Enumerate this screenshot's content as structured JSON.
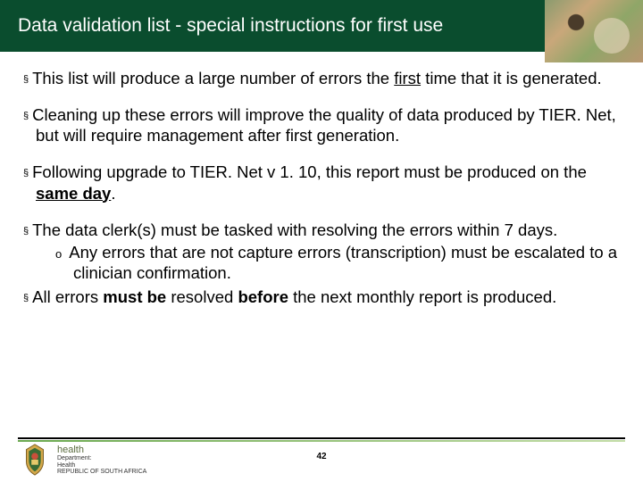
{
  "title": "Data validation list - special instructions for first use",
  "bullets": {
    "b1_pre": "This list will produce a large number of errors the ",
    "b1_u": "first",
    "b1_post": " time that it is generated.",
    "b2": "Cleaning up these errors will improve the quality of data produced by TIER. Net, but will require management after first generation.",
    "b3_pre": "Following upgrade to TIER. Net v 1. 10, this report must be produced on the ",
    "b3_bold": "same day",
    "b3_post": ".",
    "b4": "The data clerk(s) must be tasked with resolving the errors within 7 days.",
    "b4_sub": "Any errors that are not capture errors (transcription) must be escalated to a clinician confirmation.",
    "b5_pre": "All errors ",
    "b5_bold1": "must be",
    "b5_mid": " resolved ",
    "b5_bold2": "before",
    "b5_post": " the next monthly report is produced."
  },
  "footer": {
    "dept": "health",
    "sub1": "Department:",
    "sub2": "Health",
    "sub3": "REPUBLIC OF SOUTH AFRICA",
    "page": "42"
  }
}
